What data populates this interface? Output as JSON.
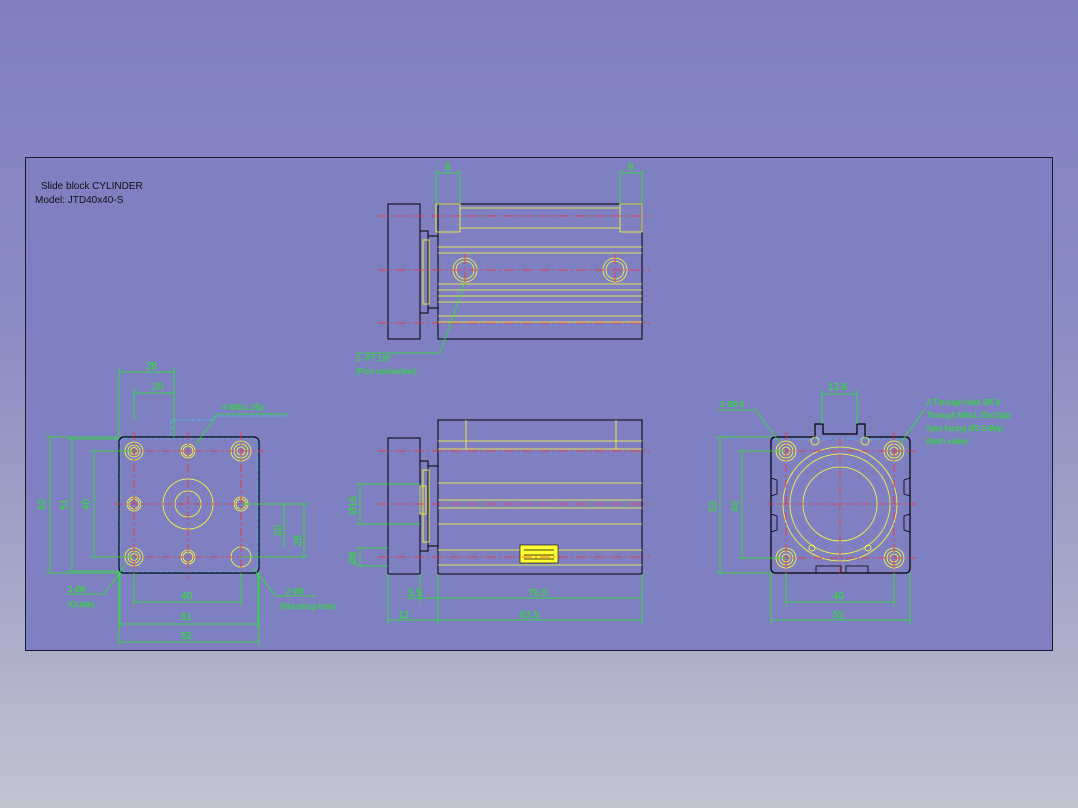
{
  "title": {
    "line1": "Slide block CYLINDER",
    "line2": "Model:  JTD40x40-S"
  },
  "top_view": {
    "dim_left": "8",
    "dim_right": "8",
    "port_note": "2- PT 1/8\"",
    "port_sub": "(Port connection)"
  },
  "front_view": {
    "dim_28": "28",
    "dim_20": "20",
    "tap_note": "4-M8x1.25p",
    "dim_52_v": "52",
    "dim_51_v": "51",
    "dim_40_v": "40",
    "dim_20_v": "20",
    "dim_28_v": "28",
    "dim_40_h": "40",
    "dim_51_h": "51",
    "dim_52_h": "52",
    "guide_note": "2-Ø8",
    "guide_sub": "(Guide)",
    "hole_note": "2-Ø8",
    "hole_sub": "(Mounting-hole)"
  },
  "side_view": {
    "dim_phi16": "Ø16",
    "dim_phi8": "Ø8",
    "dim_5_5": "5.5",
    "dim_76_5": "76.5",
    "dim_12": "12",
    "dim_83_5": "83.5"
  },
  "end_view": {
    "dim_13_6": "13.6",
    "hole_note": "2-Ø8.6",
    "through_line1": "2-Through-hole Ø6.8",
    "through_line2": "Through M8x1.25x10dp",
    "through_line3": "Spot facing Ø9.5x8dp",
    "through_line4": "(Both sides)",
    "dim_52_v": "52",
    "dim_40_v": "40",
    "dim_40_h": "40",
    "dim_52_h": "52"
  },
  "colors": {
    "background": "#7f80c2",
    "outline": "#000000",
    "feature": "#ffff33",
    "dimension": "#22ee22",
    "centerline": "#ff2a2a",
    "hidden": "#33ccff"
  }
}
